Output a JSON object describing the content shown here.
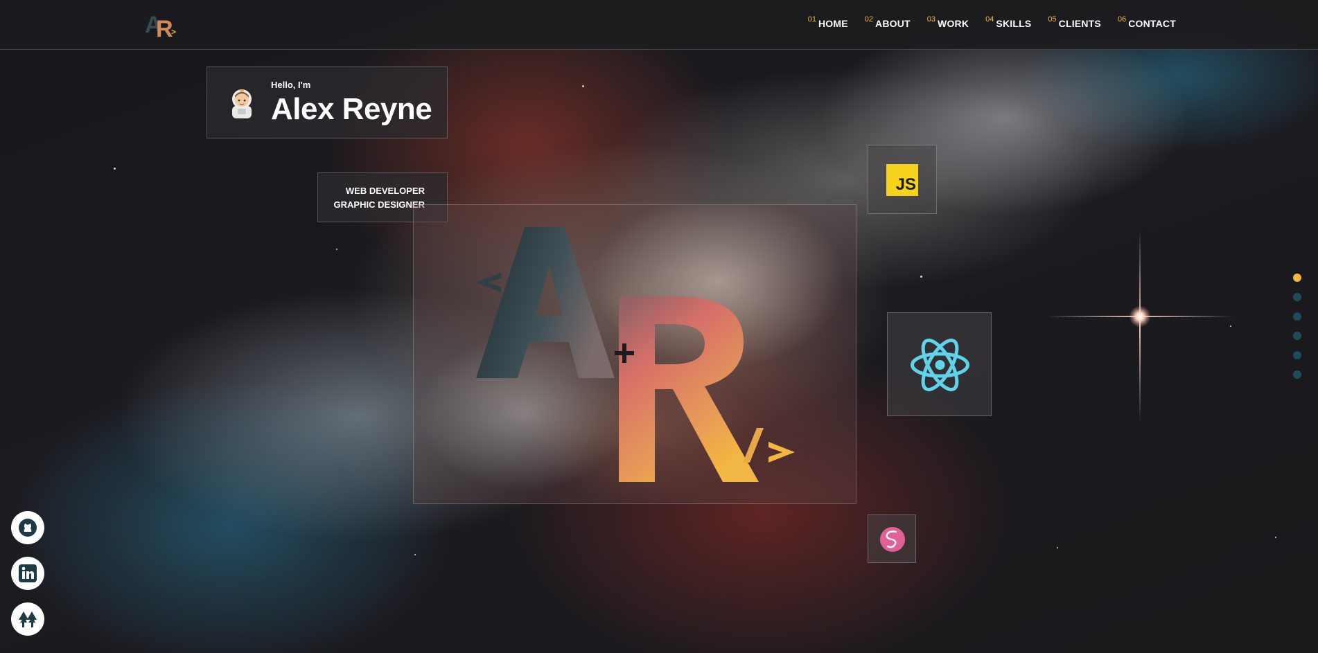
{
  "header": {
    "logo_letters": "AR",
    "nav": [
      {
        "num": "01",
        "label": "HOME"
      },
      {
        "num": "02",
        "label": "ABOUT"
      },
      {
        "num": "03",
        "label": "WORK"
      },
      {
        "num": "04",
        "label": "SKILLS"
      },
      {
        "num": "05",
        "label": "CLIENTS"
      },
      {
        "num": "06",
        "label": "CONTACT"
      }
    ]
  },
  "intro": {
    "greeting": "Hello, I'm",
    "name": "Alex Reyne",
    "avatar_icon": "astronaut-icon"
  },
  "roles": [
    "WEB DEVELOPER",
    "GRAPHIC DESIGNER"
  ],
  "hero": {
    "logo_letters": "AR",
    "logo_extras": [
      "<",
      "+",
      "/>"
    ]
  },
  "skills": [
    {
      "name": "javascript-icon",
      "text": "JS"
    },
    {
      "name": "react-icon"
    },
    {
      "name": "sass-icon"
    }
  ],
  "section_dots": {
    "count": 6,
    "active_index": 0
  },
  "socials": [
    "github-icon",
    "linkedin-icon",
    "linktree-icon"
  ],
  "colors": {
    "accent": "#f2b642",
    "react": "#5fd3e9",
    "sass": "#e16196",
    "js": "#f5d21b",
    "dot": "#1f4a5a"
  }
}
